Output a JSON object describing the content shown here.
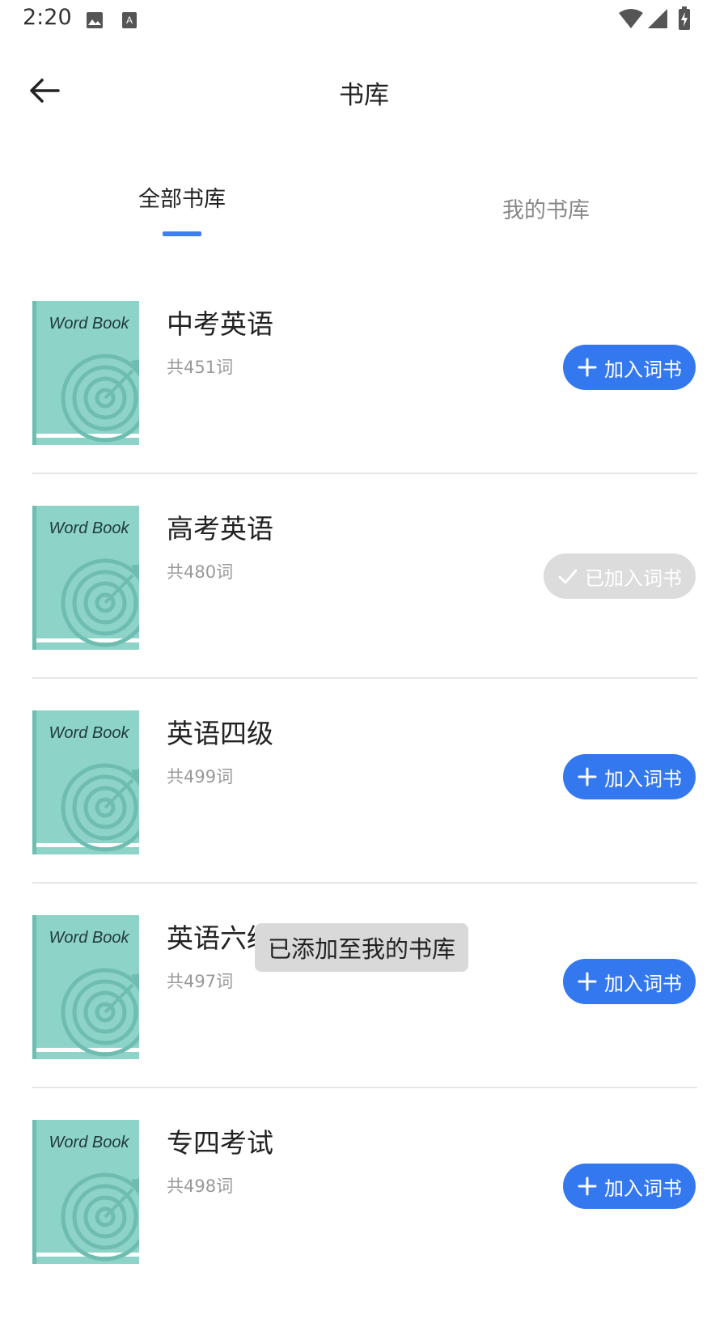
{
  "status_bar": {
    "time": "2:20"
  },
  "header": {
    "title": "书库"
  },
  "tabs": [
    {
      "label": "全部书库",
      "active": true
    },
    {
      "label": "我的书库",
      "active": false
    }
  ],
  "cover_label": "Word Book",
  "books": [
    {
      "title": "中考英语",
      "count": "共451词",
      "button": "加入词书",
      "added": false
    },
    {
      "title": "高考英语",
      "count": "共480词",
      "button": "已加入词书",
      "added": true
    },
    {
      "title": "英语四级",
      "count": "共499词",
      "button": "加入词书",
      "added": false
    },
    {
      "title": "英语六级",
      "count": "共497词",
      "button": "加入词书",
      "added": false
    },
    {
      "title": "专四考试",
      "count": "共498词",
      "button": "加入词书",
      "added": false
    }
  ],
  "toast": "已添加至我的书库",
  "colors": {
    "accent": "#3478f0",
    "cover": "#8ed3c8",
    "cover_dark": "#6fbcb0",
    "added_bg": "#dcdcdc"
  }
}
